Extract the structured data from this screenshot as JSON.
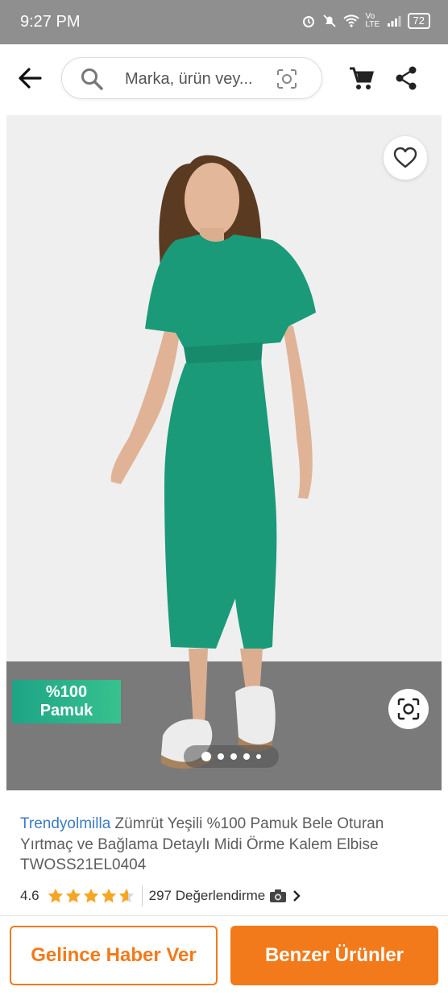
{
  "status_bar": {
    "time": "9:27 PM",
    "network": "Vo LTE",
    "battery": "72"
  },
  "header": {
    "search_placeholder": "Marka, ürün vey..."
  },
  "image": {
    "badge_line1": "%100",
    "badge_line2": "Pamuk",
    "carousel_dots": 5,
    "active_dot": 0
  },
  "product": {
    "brand": "Trendyolmilla",
    "title": " Zümrüt Yeşili %100 Pamuk Bele Oturan Yırtmaç ve Bağlama Detaylı Midi Örme Kalem Elbise TWOSS21EL0404",
    "rating": "4.6",
    "rating_value": 4.6,
    "reviews": "297 Değerlendirme"
  },
  "actions": {
    "notify": "Gelince Haber Ver",
    "similar": "Benzer Ürünler"
  },
  "colors": {
    "accent": "#f27a1a",
    "brand_link": "#3c7bc4",
    "star": "#f5a623",
    "badge": "#2bb38a",
    "dress": "#1a9a78"
  }
}
